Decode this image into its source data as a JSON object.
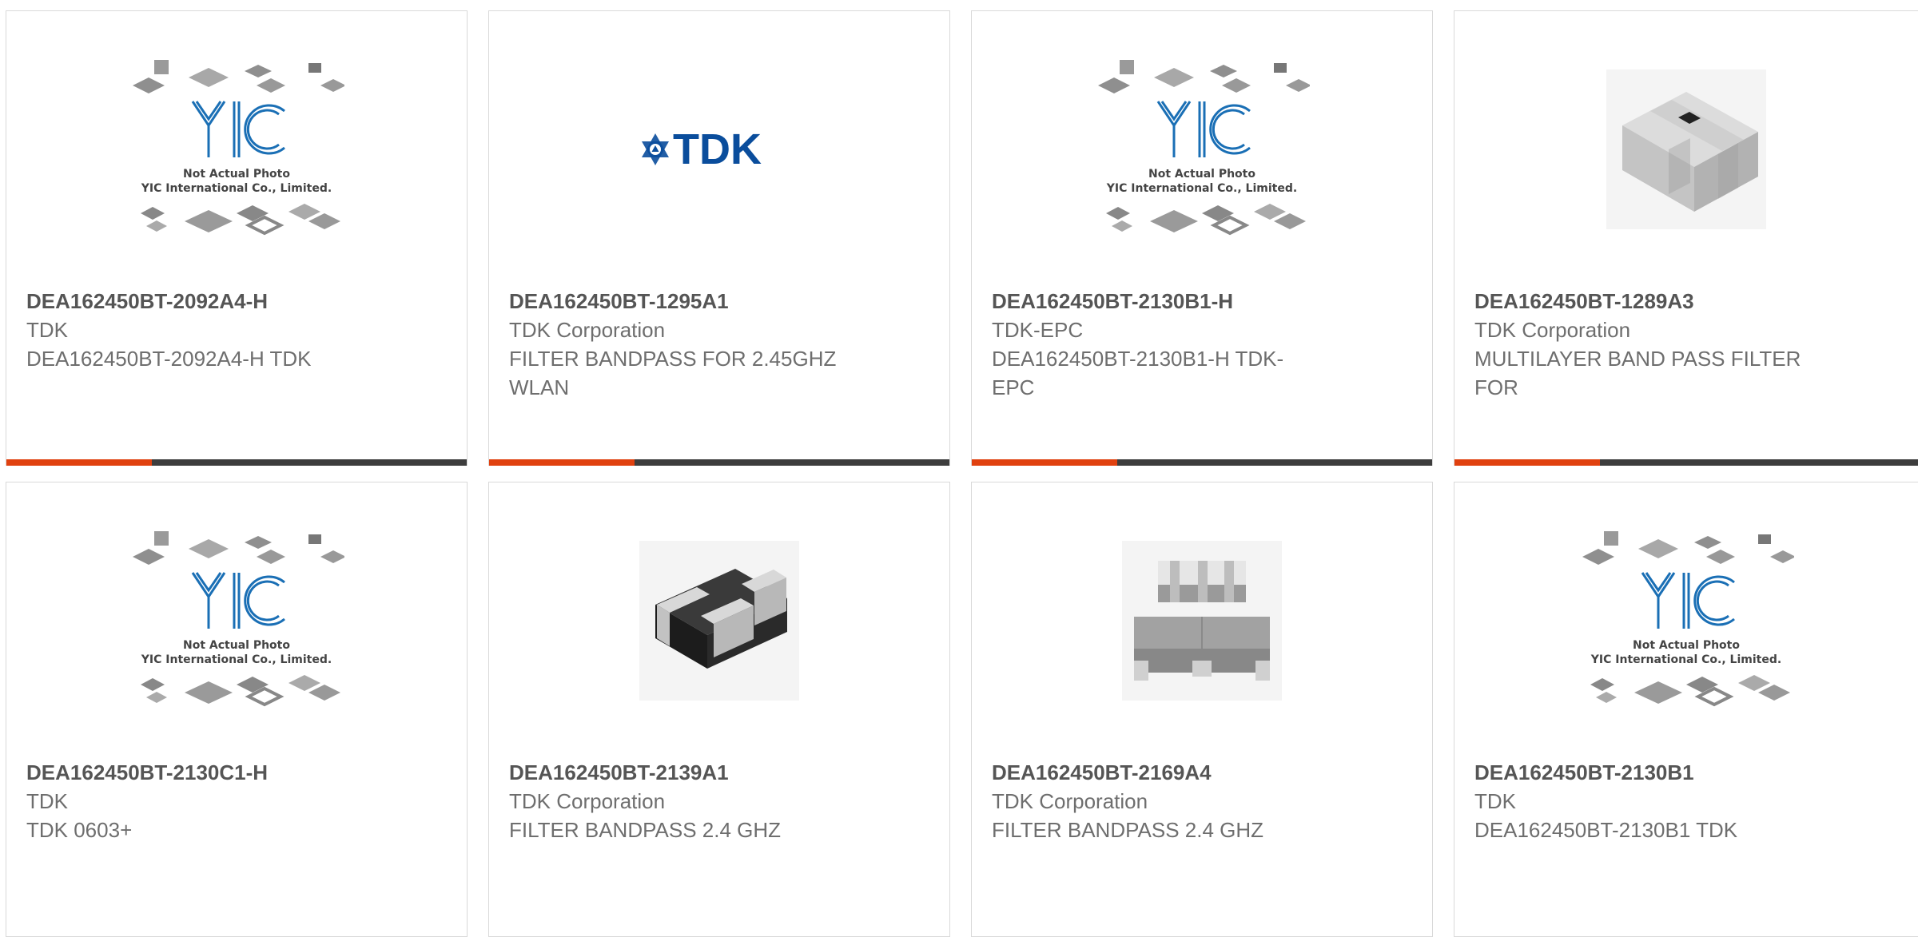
{
  "products": [
    {
      "part": "DEA162450BT-2092A4-H",
      "manufacturer": "TDK",
      "description": "DEA162450BT-2092A4-H TDK",
      "image": "yic-placeholder"
    },
    {
      "part": "DEA162450BT-1295A1",
      "manufacturer": "TDK Corporation",
      "description": "FILTER BANDPASS FOR 2.45GHZ WLAN",
      "image": "tdk-logo"
    },
    {
      "part": "DEA162450BT-2130B1-H",
      "manufacturer": "TDK-EPC",
      "description": "DEA162450BT-2130B1-H TDK-EPC",
      "image": "yic-placeholder"
    },
    {
      "part": "DEA162450BT-1289A3",
      "manufacturer": "TDK Corporation",
      "description": "MULTILAYER BAND PASS FILTER FOR",
      "image": "chip-gray-block"
    },
    {
      "part": "DEA162450BT-2130C1-H",
      "manufacturer": "TDK",
      "description": "TDK 0603+",
      "image": "yic-placeholder"
    },
    {
      "part": "DEA162450BT-2139A1",
      "manufacturer": "TDK Corporation",
      "description": "FILTER BANDPASS 2.4 GHZ",
      "image": "chip-black-smd"
    },
    {
      "part": "DEA162450BT-2169A4",
      "manufacturer": "TDK Corporation",
      "description": "FILTER BANDPASS 2.4 GHZ",
      "image": "chip-gray-pair"
    },
    {
      "part": "DEA162450BT-2130B1",
      "manufacturer": "TDK",
      "description": "DEA162450BT-2130B1 TDK",
      "image": "yic-placeholder"
    }
  ],
  "placeholder": {
    "line1": "Not Actual Photo",
    "line2": "YIC International Co., Limited.",
    "logo": "YIC"
  },
  "tdk_logo_text": "TDK",
  "colors": {
    "accent": "#e0410f",
    "bar": "#3d3d3d",
    "yic_blue": "#1a6fb5",
    "tdk_blue": "#0a4d9c"
  }
}
